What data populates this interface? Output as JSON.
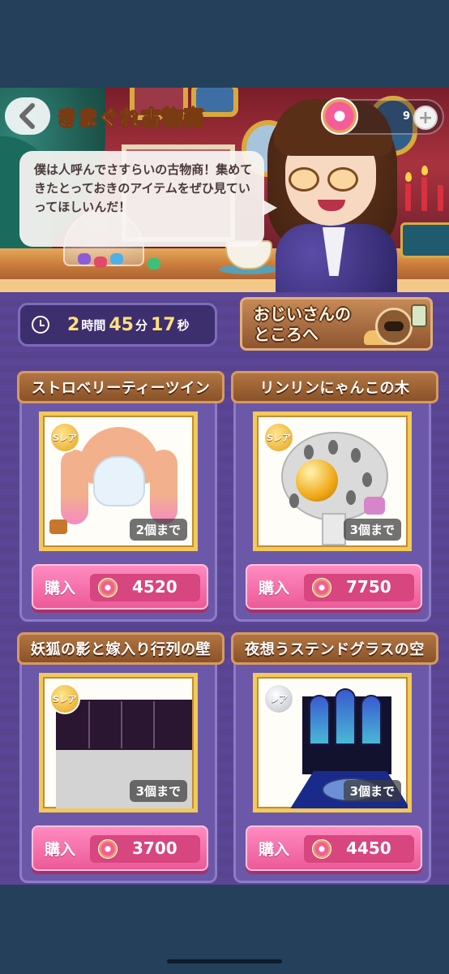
{
  "header": {
    "title": "きまぐれ古物商",
    "donut_count": "9",
    "plus_label": "+",
    "speech": "僕は人呼んでさすらいの古物商！集めてきたとっておきのアイテムをぜひ見ていってほしいんだ！"
  },
  "timer": {
    "hours": "2",
    "hours_unit": "時間",
    "minutes": "45",
    "minutes_unit": "分",
    "seconds": "17",
    "seconds_unit": "秒"
  },
  "grandpa_button": {
    "line1": "おじいさんの",
    "line2": "ところへ"
  },
  "items": [
    {
      "name": "ストロベリーティーツイン",
      "rarity": "Sレア",
      "limit": "2個まで",
      "buy_label": "購入",
      "price": "4520"
    },
    {
      "name": "リンリンにゃんこの木",
      "rarity": "Sレア",
      "limit": "3個まで",
      "buy_label": "購入",
      "price": "7750"
    },
    {
      "name": "妖狐の影と嫁入り行列の壁",
      "rarity": "Sレア",
      "limit": "3個まで",
      "buy_label": "購入",
      "price": "3700"
    },
    {
      "name": "夜想うステンドグラスの空",
      "rarity": "レア",
      "limit": "3個まで",
      "buy_label": "購入",
      "price": "4450"
    }
  ],
  "colors": {
    "background": "#24405a",
    "panel": "#5b4596",
    "buy_pink": "#ec5a98",
    "title_brown": "#8a5229",
    "timer_yellow": "#ffe07a"
  }
}
